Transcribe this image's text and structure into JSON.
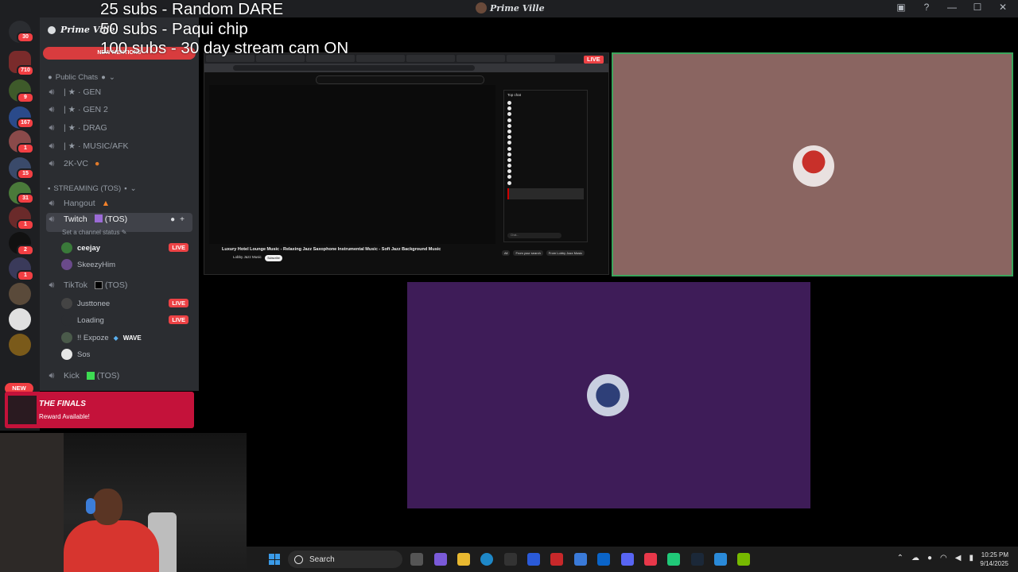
{
  "window": {
    "title": "Prime Ville"
  },
  "overlay": {
    "lines": [
      "25 subs - Random DARE",
      "50 subs - Paqui chip",
      "100 subs - 30 day stream cam ON"
    ]
  },
  "servers": {
    "badges": [
      "30",
      "710",
      "9",
      "167",
      "1",
      "15",
      "31",
      "1",
      "2",
      "1"
    ],
    "new_label": "NEW"
  },
  "sidebar": {
    "server_name": "Prime Ville",
    "new_mentions": "NEW MENTIONS",
    "categories": {
      "public": "Public Chats",
      "streaming": "STREAMING (TOS)"
    },
    "channels": {
      "gen": "| ★ · GEN",
      "gen2": "| ★ · GEN 2",
      "drag": "| ★ · DRAG",
      "music": "| ★ · MUSIC/AFK",
      "twok": "2K-VC",
      "hangout": "Hangout",
      "twitch": "Twitch",
      "twitch_suffix": "(TOS)",
      "twitch_status": "Set a channel status",
      "tiktok": "TikTok",
      "tiktok_suffix": "(TOS)",
      "kick": "Kick",
      "kick_suffix": "(TOS)"
    },
    "twitch_users": [
      {
        "name": "ceejay",
        "live": "LIVE"
      },
      {
        "name": "SkeezyHim",
        "live": ""
      }
    ],
    "tiktok_users": [
      {
        "name": "Justtonee",
        "live": "LIVE"
      },
      {
        "name": "Loading",
        "live": "LIVE"
      },
      {
        "name": "!! Expoze",
        "tag": "WAVE"
      },
      {
        "name": "Sos"
      }
    ]
  },
  "finals": {
    "title": "THE FINALS",
    "subtitle": "Reward Available!"
  },
  "share": {
    "live_badge": "LIVE",
    "video_title": "Luxury Hotel Lounge Music - Relaxing Jazz Saxophone Instrumental Music - Soft Jazz Background Music",
    "channel": "Lobby Jazz Music",
    "subscribe": "Subscribe",
    "chat_header": "Top chat",
    "upnext": [
      "All",
      "From your search",
      "From Lobby Jazz Music"
    ],
    "chat_input": "Chat..."
  },
  "taskbar": {
    "search_label": "Search",
    "time": "10:25 PM",
    "date": "9/14/2025"
  },
  "colors": {
    "accent": "#3ba55c",
    "live": "#ed4245",
    "tile_top": "#8a6561",
    "tile_bottom": "#3e1c58"
  }
}
